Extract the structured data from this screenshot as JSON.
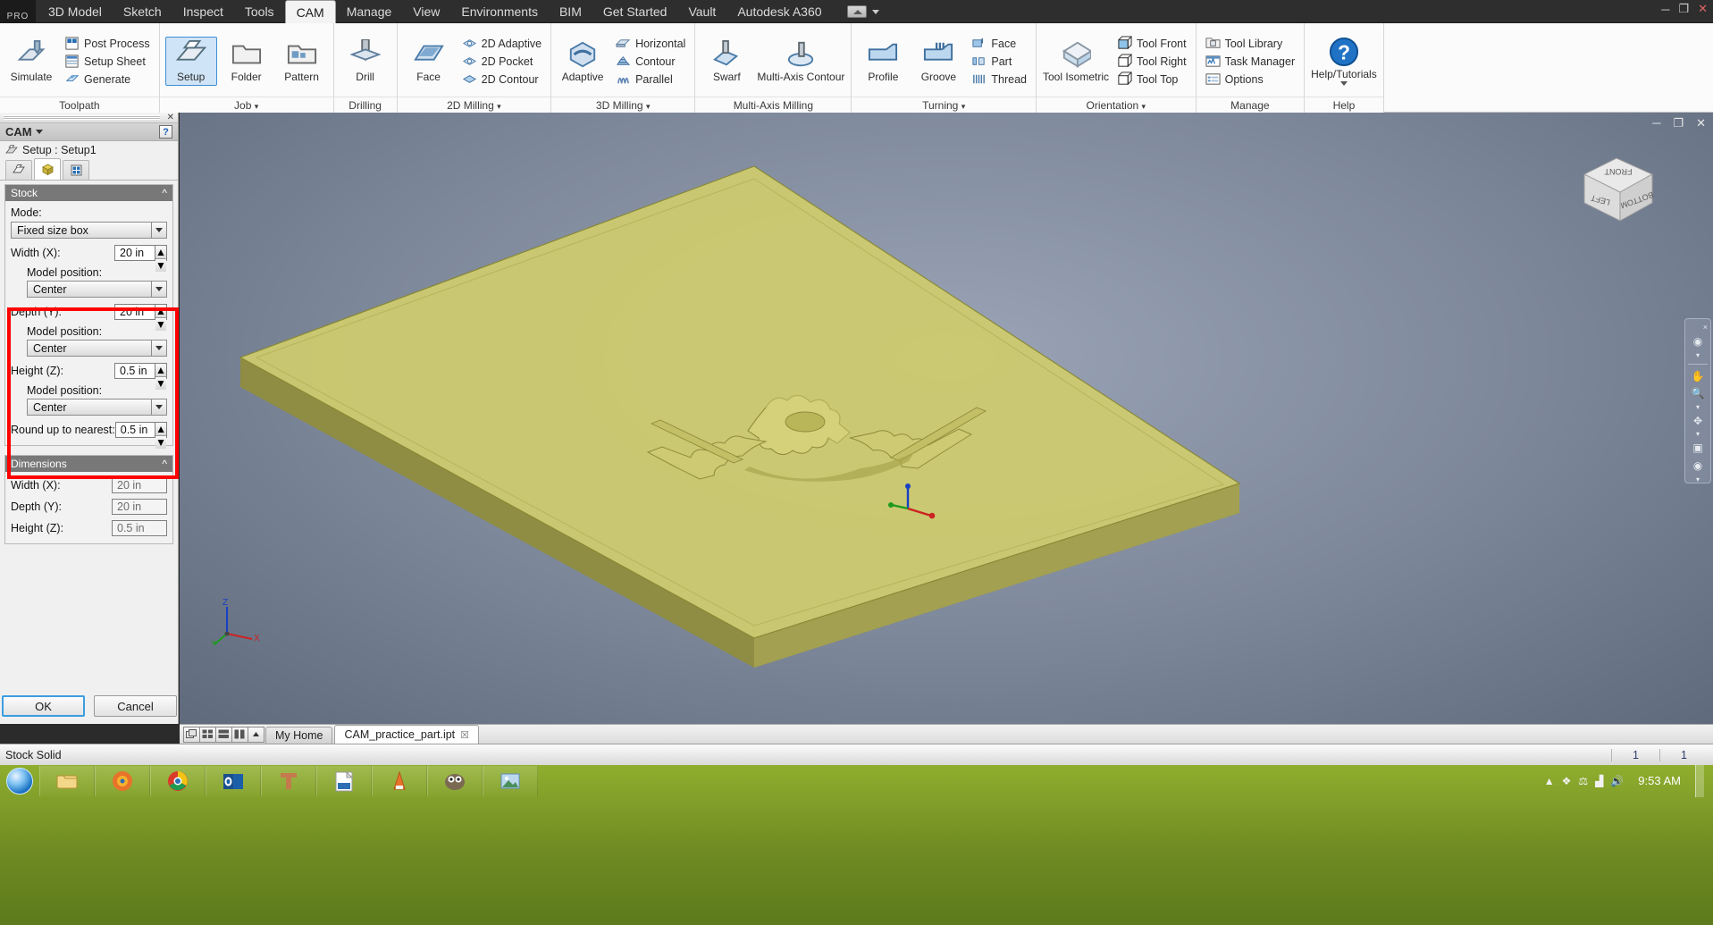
{
  "window": {
    "product_badge": "PRO",
    "minimize": "─",
    "restore": "❐",
    "close": "✕"
  },
  "menubar": {
    "tabs": [
      {
        "label": "3D Model",
        "active": false
      },
      {
        "label": "Sketch",
        "active": false
      },
      {
        "label": "Inspect",
        "active": false
      },
      {
        "label": "Tools",
        "active": false
      },
      {
        "label": "CAM",
        "active": true
      },
      {
        "label": "Manage",
        "active": false
      },
      {
        "label": "View",
        "active": false
      },
      {
        "label": "Environments",
        "active": false
      },
      {
        "label": "BIM",
        "active": false
      },
      {
        "label": "Get Started",
        "active": false
      },
      {
        "label": "Vault",
        "active": false
      },
      {
        "label": "Autodesk A360",
        "active": false
      }
    ]
  },
  "ribbon": {
    "panels": [
      {
        "title": "Toolpath",
        "big": [
          {
            "label": "Simulate",
            "icon": "simulate-icon",
            "selected": false
          }
        ],
        "small": [
          {
            "label": "Post Process",
            "icon": "post-process-icon"
          },
          {
            "label": "Setup Sheet",
            "icon": "setup-sheet-icon"
          },
          {
            "label": "Generate",
            "icon": "generate-icon"
          }
        ]
      },
      {
        "title": "Job",
        "title_dropdown": true,
        "big": [
          {
            "label": "Setup",
            "icon": "setup-icon",
            "selected": true
          },
          {
            "label": "Folder",
            "icon": "folder-icon",
            "selected": false
          },
          {
            "label": "Pattern",
            "icon": "pattern-icon",
            "selected": false
          }
        ],
        "small": []
      },
      {
        "title": "Drilling",
        "big": [
          {
            "label": "Drill",
            "icon": "drill-icon",
            "selected": false
          }
        ],
        "small": []
      },
      {
        "title": "2D Milling",
        "title_dropdown": true,
        "big": [
          {
            "label": "Face",
            "icon": "face-milling-icon",
            "selected": false
          }
        ],
        "small": [
          {
            "label": "2D Adaptive",
            "icon": "2d-adaptive-icon"
          },
          {
            "label": "2D Pocket",
            "icon": "2d-pocket-icon"
          },
          {
            "label": "2D Contour",
            "icon": "2d-contour-icon"
          }
        ]
      },
      {
        "title": "3D Milling",
        "title_dropdown": true,
        "big": [
          {
            "label": "Adaptive",
            "icon": "adaptive-icon",
            "selected": false
          }
        ],
        "small": [
          {
            "label": "Horizontal",
            "icon": "horizontal-icon"
          },
          {
            "label": "Contour",
            "icon": "contour-icon"
          },
          {
            "label": "Parallel",
            "icon": "parallel-icon"
          }
        ]
      },
      {
        "title": "Multi-Axis Milling",
        "big": [
          {
            "label": "Swarf",
            "icon": "swarf-icon",
            "selected": false
          },
          {
            "label": "Multi-Axis Contour",
            "icon": "multi-axis-contour-icon",
            "selected": false
          }
        ],
        "small": []
      },
      {
        "title": "Turning",
        "title_dropdown": true,
        "big": [
          {
            "label": "Profile",
            "icon": "turning-profile-icon",
            "selected": false
          },
          {
            "label": "Groove",
            "icon": "turning-groove-icon",
            "selected": false
          }
        ],
        "small": [
          {
            "label": "Face",
            "icon": "turning-face-icon"
          },
          {
            "label": "Part",
            "icon": "turning-part-icon"
          },
          {
            "label": "Thread",
            "icon": "turning-thread-icon"
          }
        ]
      },
      {
        "title": "Orientation",
        "title_dropdown": true,
        "big": [
          {
            "label": "Tool Isometric",
            "icon": "tool-isometric-icon",
            "selected": false
          }
        ],
        "small": [
          {
            "label": "Tool Front",
            "icon": "tool-front-icon"
          },
          {
            "label": "Tool Right",
            "icon": "tool-right-icon"
          },
          {
            "label": "Tool Top",
            "icon": "tool-top-icon"
          }
        ]
      },
      {
        "title": "Manage",
        "big": [],
        "small": [
          {
            "label": "Tool Library",
            "icon": "tool-library-icon"
          },
          {
            "label": "Task Manager",
            "icon": "task-manager-icon"
          },
          {
            "label": "Options",
            "icon": "options-icon"
          }
        ]
      },
      {
        "title": "Help",
        "big": [
          {
            "label": "Help/Tutorials",
            "icon": "help-icon",
            "selected": false,
            "dropdown": true
          }
        ],
        "small": []
      }
    ]
  },
  "browser": {
    "panel_title": "CAM",
    "panel_close": "✕",
    "help_label": "?",
    "setup_node": "Setup : Setup1",
    "tabs": [
      {
        "name": "geometry-tab",
        "label": "",
        "active": false
      },
      {
        "name": "stock-tab",
        "label": "",
        "active": true
      },
      {
        "name": "post-process-tab",
        "label": "",
        "active": false
      }
    ],
    "stock": {
      "title": "Stock",
      "mode_label": "Mode:",
      "mode_value": "Fixed size box",
      "width_label": "Width (X):",
      "width_value": "20 in",
      "width_model_position_label": "Model position:",
      "width_model_position_value": "Center",
      "depth_label": "Depth (Y):",
      "depth_value": "20 in",
      "depth_model_position_label": "Model position:",
      "depth_model_position_value": "Center",
      "height_label": "Height (Z):",
      "height_value": "0.5 in",
      "height_model_position_label": "Model position:",
      "height_model_position_value": "Center",
      "round_label": "Round up to nearest:",
      "round_value": "0.5 in"
    },
    "dimensions": {
      "title": "Dimensions",
      "rows": [
        {
          "label": "Width (X):",
          "value": "20 in"
        },
        {
          "label": "Depth (Y):",
          "value": "20 in"
        },
        {
          "label": "Height (Z):",
          "value": "0.5 in"
        }
      ]
    },
    "ok_label": "OK",
    "cancel_label": "Cancel"
  },
  "viewport": {
    "viewcube_faces": {
      "top": "FRONT",
      "left": "LEFT",
      "right": "BOTTOM"
    },
    "triad_axes": {
      "x": "X",
      "y": "Y",
      "z": "Z"
    },
    "nav_items": [
      "steering-wheel-icon",
      "pan-icon",
      "zoom-icon",
      "orbit-icon",
      "look-at-icon",
      "show-motion-icon"
    ],
    "nav_close": "×",
    "stock_color": "#cfcc6e",
    "stock_side_color": "#9c9a4b",
    "background_top": "#9aa4b6",
    "background_bottom": "#5f6a7d"
  },
  "doctabs": {
    "view_toggles": [
      "tile-icon",
      "grid-icon",
      "stack-icon",
      "split-icon",
      "more-icon"
    ],
    "tabs": [
      {
        "label": "My Home",
        "active": false,
        "closable": false
      },
      {
        "label": "CAM_practice_part.ipt",
        "active": true,
        "closable": true,
        "close": "☒"
      }
    ]
  },
  "statusbar": {
    "message": "Stock Solid",
    "cells": [
      "1",
      "1"
    ]
  },
  "taskbar": {
    "start_label": "start-orb-icon",
    "items": [
      "explorer-icon",
      "firefox-icon",
      "chrome-icon",
      "outlook-icon",
      "inventor-icon",
      "pdf-icon",
      "vlc-icon",
      "gimp-icon",
      "photo-viewer-icon"
    ],
    "tray_icons": [
      "show-hidden-icon",
      "dropbox-icon",
      "battery-icon",
      "network-icon",
      "volume-icon"
    ],
    "clock_time": "9:53 AM"
  }
}
